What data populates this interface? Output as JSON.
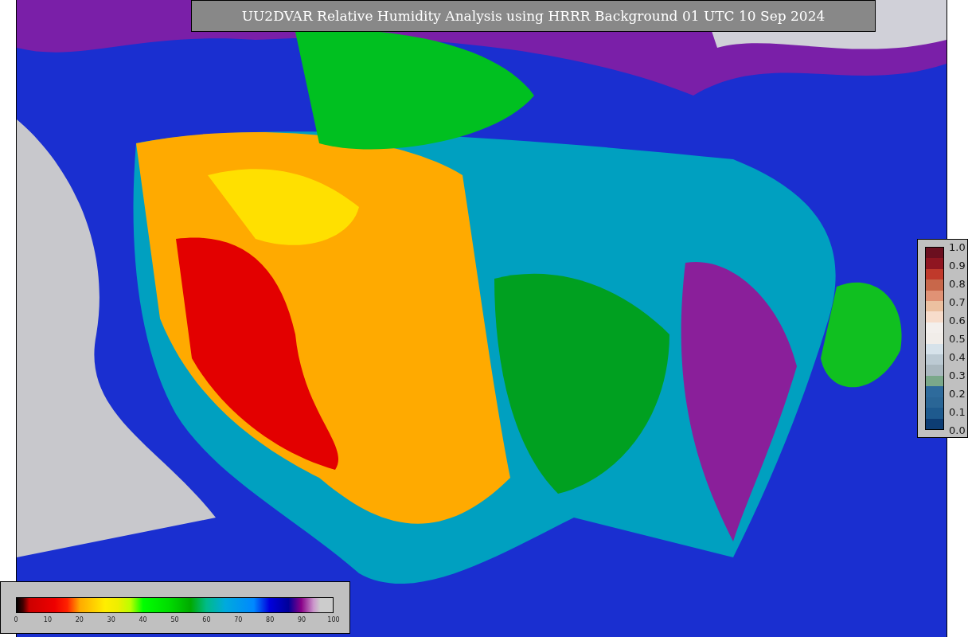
{
  "title": "UU2DVAR Relative Humidity Analysis using HRRR Background 01 UTC 10 Sep 2024",
  "humidity_colorbar": {
    "ticks": [
      "0",
      "10",
      "20",
      "30",
      "40",
      "50",
      "60",
      "70",
      "80",
      "90",
      "100"
    ]
  },
  "ratio_colorbar": {
    "ticks": [
      "1.0",
      "0.9",
      "0.8",
      "0.7",
      "0.6",
      "0.5",
      "0.4",
      "0.3",
      "0.2",
      "0.1",
      "0.0"
    ]
  }
}
